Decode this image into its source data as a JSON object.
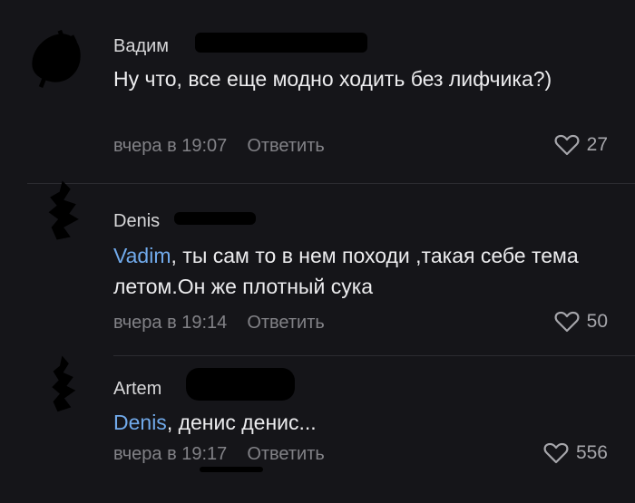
{
  "comments": [
    {
      "author": "Вадим",
      "text": "Ну что, все еще модно ходить без лифчика?)",
      "mention": "",
      "time": "вчера в 19:07",
      "reply_label": "Ответить",
      "likes": "27"
    },
    {
      "author": "Denis",
      "mention": "Vadim",
      "text": ", ты сам то в нем походи ,такая себе тема летом.Он же плотный сука",
      "time": "вчера в 19:14",
      "reply_label": "Ответить",
      "likes": "50"
    },
    {
      "author": "Artem",
      "mention": "Denis",
      "text": ", денис денис...",
      "time": "вчера в 19:17",
      "reply_label": "Ответить",
      "likes": "556"
    }
  ],
  "colors": {
    "background": "#151519",
    "mention": "#71aaeb",
    "meta": "#828287"
  }
}
